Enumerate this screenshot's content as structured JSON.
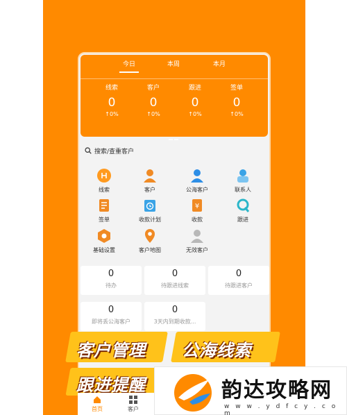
{
  "tabs": [
    "今日",
    "本周",
    "本月"
  ],
  "stats": [
    {
      "label": "线索",
      "value": "0",
      "pct": "↑0%"
    },
    {
      "label": "客户",
      "value": "0",
      "pct": "↑0%"
    },
    {
      "label": "跟进",
      "value": "0",
      "pct": "↑0%"
    },
    {
      "label": "签单",
      "value": "0",
      "pct": "↑0%"
    }
  ],
  "search": {
    "placeholder": "搜索/查重客户"
  },
  "menu": [
    {
      "label": "线索",
      "icon": "clue-icon",
      "color": "#ff9a1f"
    },
    {
      "label": "客户",
      "icon": "customer-icon",
      "color": "#f08a24"
    },
    {
      "label": "公海客户",
      "icon": "public-customer-icon",
      "color": "#2d8ee6"
    },
    {
      "label": "联系人",
      "icon": "contact-icon",
      "color": "#3aa3e6"
    },
    {
      "label": "签单",
      "icon": "contract-icon",
      "color": "#f08a24"
    },
    {
      "label": "收款计划",
      "icon": "payment-plan-icon",
      "color": "#3aa3e6"
    },
    {
      "label": "收款",
      "icon": "payment-icon",
      "color": "#f08a24"
    },
    {
      "label": "跟进",
      "icon": "follow-up-icon",
      "color": "#2bb6c9"
    },
    {
      "label": "基础设置",
      "icon": "settings-icon",
      "color": "#f08a24"
    },
    {
      "label": "客户地图",
      "icon": "map-pin-icon",
      "color": "#f08a24"
    },
    {
      "label": "无效客户",
      "icon": "invalid-customer-icon",
      "color": "#b8b8b8"
    }
  ],
  "counts": [
    {
      "value": "0",
      "label": "待办"
    },
    {
      "value": "0",
      "label": "待跟进线索"
    },
    {
      "value": "0",
      "label": "待跟进客户"
    },
    {
      "value": "0",
      "label": "即将丢公海客户"
    },
    {
      "value": "0",
      "label": "3天内到期收款..."
    }
  ],
  "banner": {
    "line1a": "客户管理",
    "line1b": "公海线索",
    "line2": "跟进提醒"
  },
  "nav": [
    {
      "label": "首页"
    },
    {
      "label": "客户"
    }
  ],
  "logo": {
    "text": "韵达攻略网",
    "url": "w w w . y d f c y . c o m"
  }
}
